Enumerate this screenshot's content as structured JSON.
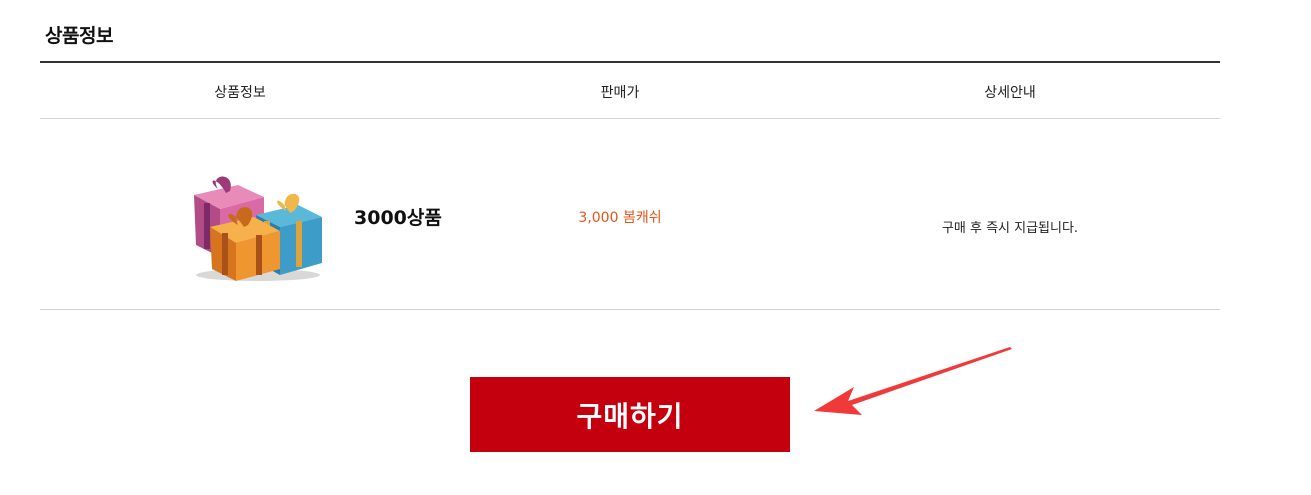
{
  "section": {
    "title": "상품정보"
  },
  "table": {
    "headers": {
      "info": "상품정보",
      "price": "판매가",
      "detail": "상세안내"
    },
    "row": {
      "name": "3000상품",
      "price": "3,000 봄캐쉬",
      "detail": "구매 후 즉시 지급됩니다."
    }
  },
  "buy_button": {
    "label": "구매하기"
  },
  "colors": {
    "accent": "#c4000e",
    "price": "#e2541b",
    "arrow": "#f03a3a"
  },
  "icons": {
    "product_image": "gift-boxes-icon",
    "annotation": "arrow-pointer-icon"
  }
}
